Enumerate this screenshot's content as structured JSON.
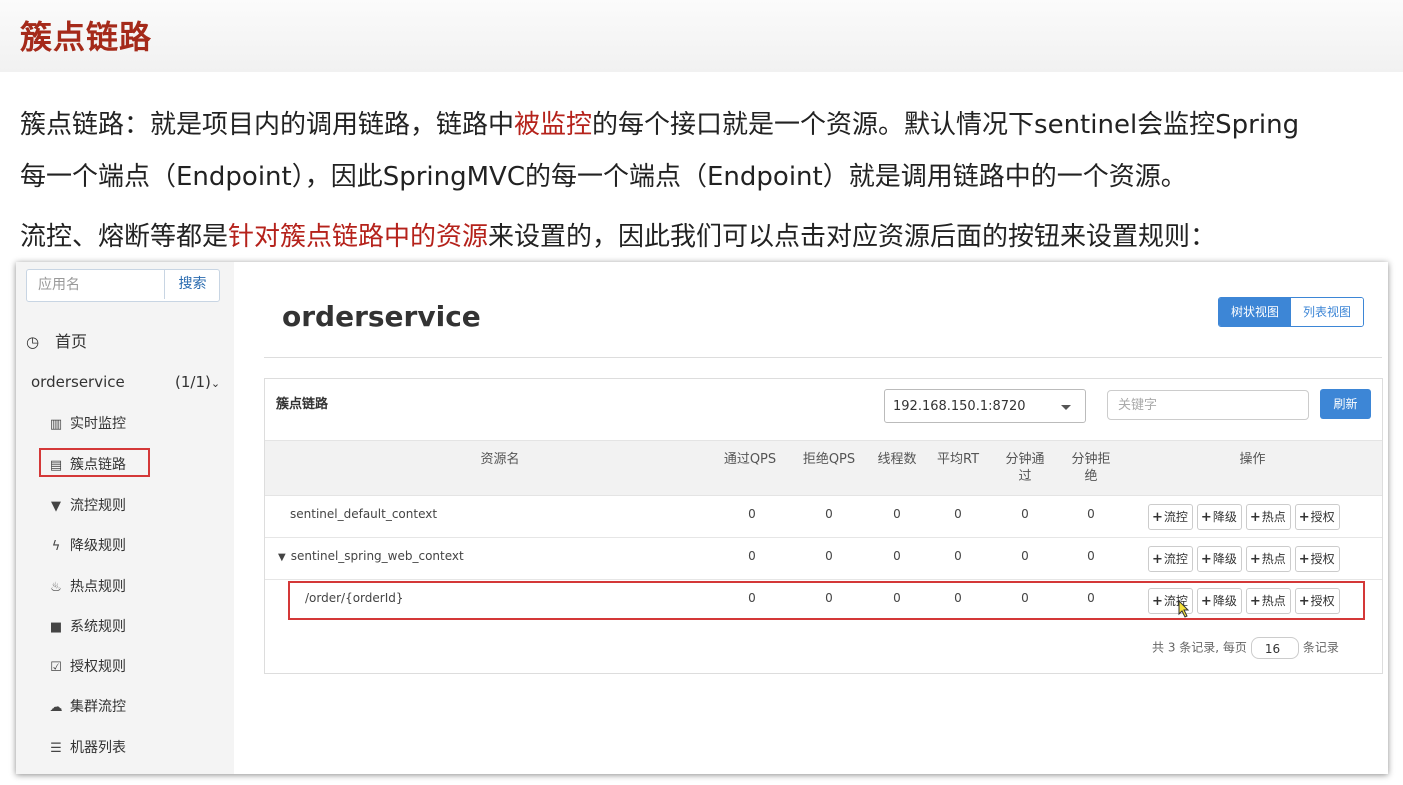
{
  "doc": {
    "title": "簇点链路",
    "p1_a": "簇点链路：就是项目内的调用链路，链路中",
    "p1_red": "被监控",
    "p1_b": "的每个接口就是一个资源。默认情况下sentinel会监控Spring",
    "p2": "每一个端点（Endpoint），因此SpringMVC的每一个端点（Endpoint）就是调用链路中的一个资源。",
    "p3_a": "流控、熔断等都是",
    "p3_red": "针对簇点链路中的资源",
    "p3_b": "来设置的，因此我们可以点击对应资源后面的按钮来设置规则："
  },
  "sidebar": {
    "search_placeholder": "应用名",
    "search_button": "搜索",
    "home": "首页",
    "app_name": "orderservice",
    "app_count": "(1/1)",
    "items": [
      {
        "label": "实时监控",
        "icon": "bar-chart-icon"
      },
      {
        "label": "簇点链路",
        "icon": "list-icon"
      },
      {
        "label": "流控规则",
        "icon": "filter-icon"
      },
      {
        "label": "降级规则",
        "icon": "bolt-icon"
      },
      {
        "label": "热点规则",
        "icon": "fire-icon"
      },
      {
        "label": "系统规则",
        "icon": "lock-icon"
      },
      {
        "label": "授权规则",
        "icon": "check-square-icon"
      },
      {
        "label": "集群流控",
        "icon": "cloud-icon"
      },
      {
        "label": "机器列表",
        "icon": "th-list-icon"
      }
    ]
  },
  "main": {
    "title": "orderservice",
    "view_tree": "树状视图",
    "view_list": "列表视图"
  },
  "panel": {
    "title": "簇点链路",
    "machine": "192.168.150.1:8720",
    "keyword_placeholder": "关键字",
    "refresh": "刷新",
    "columns": [
      "资源名",
      "通过QPS",
      "拒绝QPS",
      "线程数",
      "平均RT",
      "分钟通过",
      "分钟拒绝",
      "操作"
    ],
    "rows": [
      {
        "name": "sentinel_default_context",
        "pass_qps": "0",
        "block_qps": "0",
        "threads": "0",
        "avg_rt": "0",
        "min_pass": "0",
        "min_block": "0"
      },
      {
        "name": "sentinel_spring_web_context",
        "pass_qps": "0",
        "block_qps": "0",
        "threads": "0",
        "avg_rt": "0",
        "min_pass": "0",
        "min_block": "0"
      },
      {
        "name": "/order/{orderId}",
        "pass_qps": "0",
        "block_qps": "0",
        "threads": "0",
        "avg_rt": "0",
        "min_pass": "0",
        "min_block": "0"
      }
    ],
    "ops": [
      "流控",
      "降级",
      "热点",
      "授权"
    ],
    "pager_prefix": "共 3 条记录, 每页",
    "page_size": "16",
    "pager_suffix": "条记录"
  }
}
